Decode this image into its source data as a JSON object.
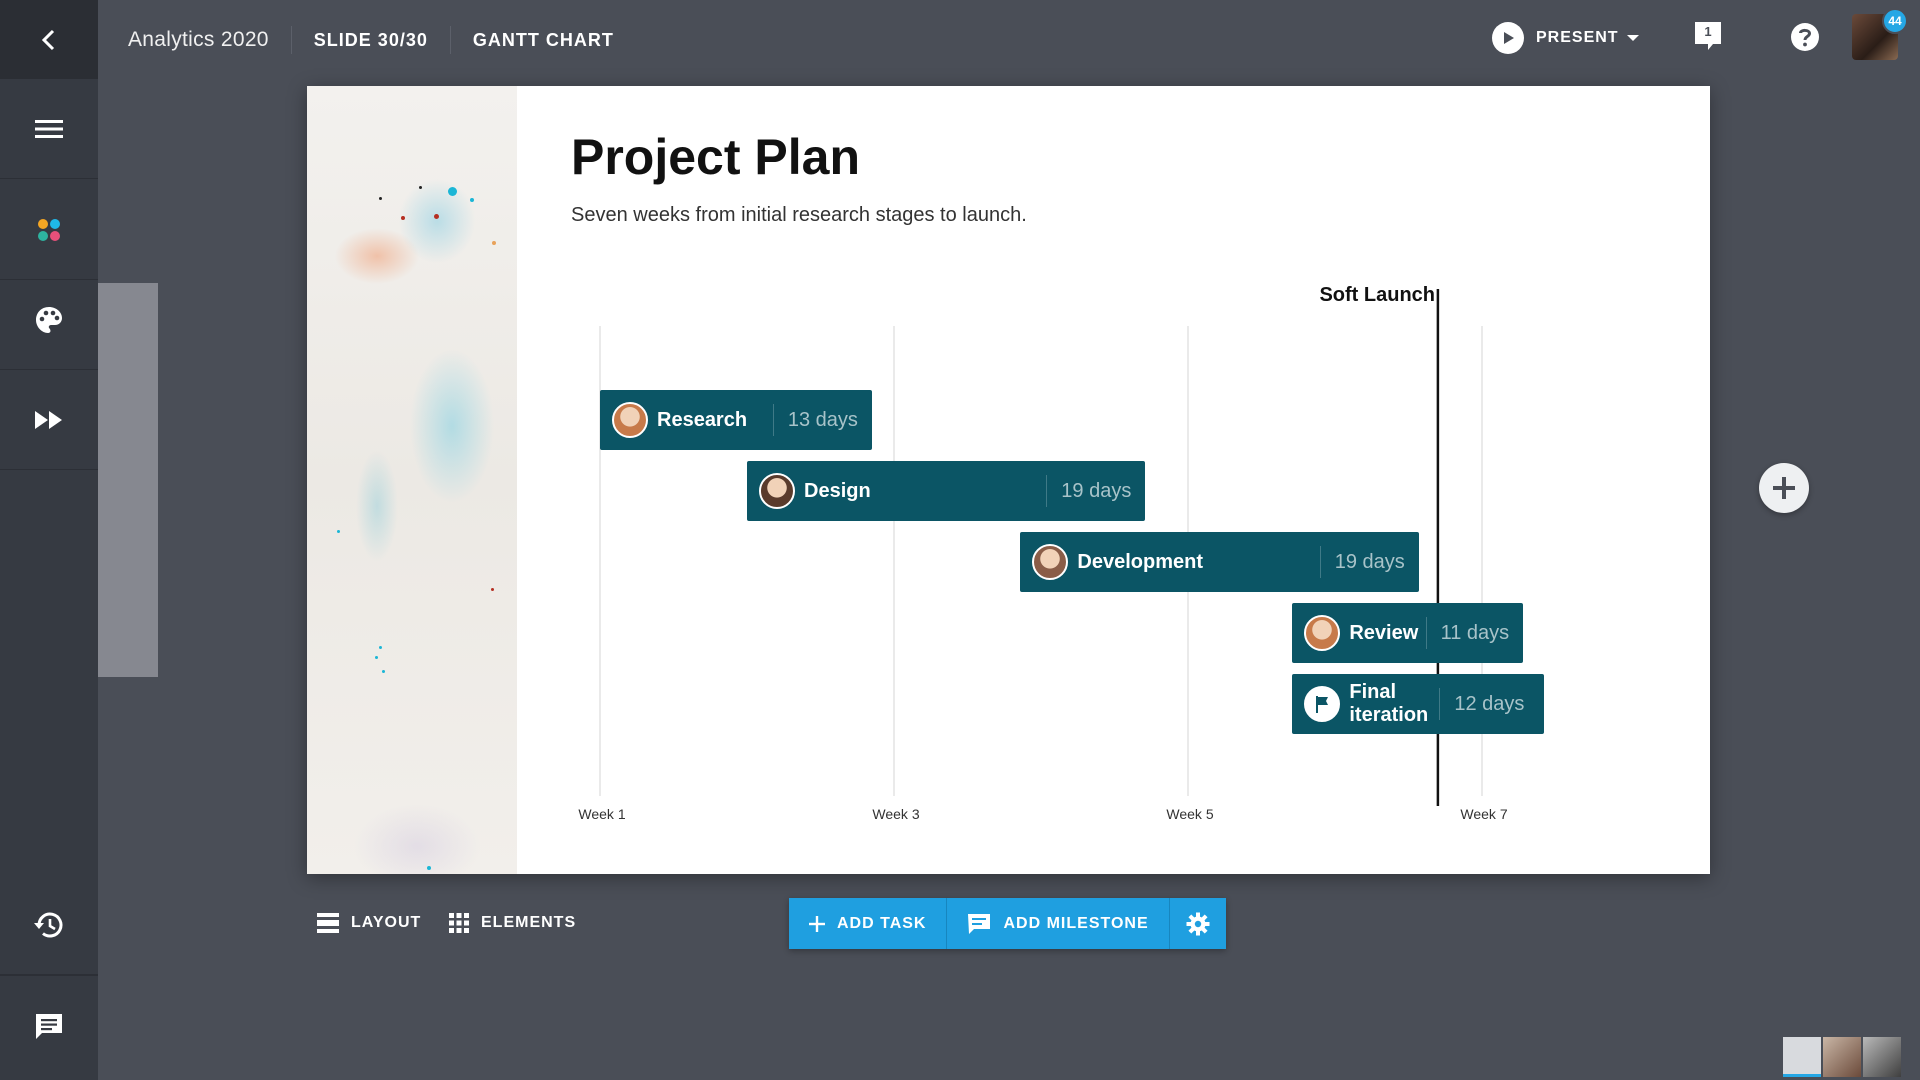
{
  "app": {
    "title": "Analytics 2020",
    "slide_indicator": "SLIDE 30/30",
    "slide_type": "GANTT CHART"
  },
  "topbar": {
    "present_label": "PRESENT",
    "comment_count": "1",
    "notification_count": "44"
  },
  "rail": {
    "items": [
      "menu-icon",
      "palette-dots-icon",
      "theme-icon",
      "animate-icon",
      "history-icon",
      "chat-icon"
    ]
  },
  "slide": {
    "title": "Project Plan",
    "subtitle": "Seven weeks from initial research stages to launch."
  },
  "chart_data": {
    "type": "gantt",
    "x_axis_ticks": [
      "Week 1",
      "Week 3",
      "Week 5",
      "Week 7"
    ],
    "milestone": {
      "label": "Soft Launch",
      "week": 6.7
    },
    "tasks": [
      {
        "name": "Research",
        "duration": "13 days",
        "start_week": 1.0,
        "end_week": 2.85,
        "assignee_color": "#c77a4a"
      },
      {
        "name": "Design",
        "duration": "19 days",
        "start_week": 2.0,
        "end_week": 4.71,
        "assignee_color": "#5a3b2c"
      },
      {
        "name": "Development",
        "duration": "19 days",
        "start_week": 3.86,
        "end_week": 6.57,
        "assignee_color": "#8a5d48"
      },
      {
        "name": "Review",
        "duration": "11 days",
        "start_week": 5.71,
        "end_week": 7.28,
        "assignee_color": "#c77a4a"
      },
      {
        "name": "Final iteration",
        "duration": "12 days",
        "start_week": 5.71,
        "end_week": 7.42,
        "flag": true
      }
    ]
  },
  "bottom": {
    "layout_label": "LAYOUT",
    "elements_label": "ELEMENTS",
    "add_task_label": "ADD TASK",
    "add_milestone_label": "ADD MILESTONE"
  },
  "colors": {
    "bar": "#0b5565",
    "accent": "#1f9fe0",
    "background": "#4a4e57",
    "rail": "#363a42"
  }
}
